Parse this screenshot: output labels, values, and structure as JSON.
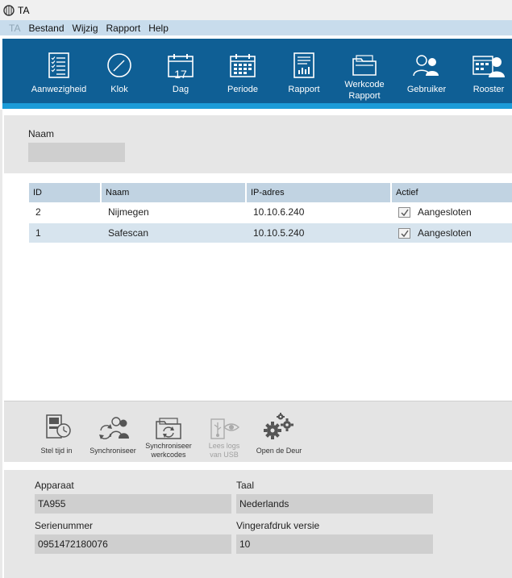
{
  "window": {
    "title": "TA"
  },
  "menu": {
    "items": [
      "TA",
      "Bestand",
      "Wijzig",
      "Rapport",
      "Help"
    ]
  },
  "toolbar": {
    "buttons": [
      {
        "label": "Aanwezigheid",
        "icon": "attendance-list-icon"
      },
      {
        "label": "Klok",
        "icon": "clock-icon"
      },
      {
        "label": "Dag",
        "icon": "calendar-day-icon",
        "day_number": "17"
      },
      {
        "label": "Periode",
        "icon": "calendar-period-icon"
      },
      {
        "label": "Rapport",
        "icon": "report-icon"
      },
      {
        "label_line1": "Werkcode",
        "label_line2": "Rapport",
        "icon": "folder-report-icon"
      },
      {
        "label": "Gebruiker",
        "icon": "users-icon"
      },
      {
        "label": "Rooster",
        "icon": "schedule-icon"
      }
    ]
  },
  "filter": {
    "name_label": "Naam",
    "name_value": ""
  },
  "devices_table": {
    "columns": [
      "ID",
      "Naam",
      "IP-adres",
      "Actief"
    ],
    "rows": [
      {
        "id": "2",
        "naam": "Nijmegen",
        "ip": "10.10.6.240",
        "actief": "Aangesloten",
        "checked": true
      },
      {
        "id": "1",
        "naam": "Safescan",
        "ip": "10.10.5.240",
        "actief": "Aangesloten",
        "checked": true
      }
    ]
  },
  "actions": [
    {
      "label": "Stel tijd in",
      "icon": "set-time-icon",
      "enabled": true
    },
    {
      "label": "Synchroniseer",
      "icon": "sync-users-icon",
      "enabled": true
    },
    {
      "label_line1": "Synchroniseer",
      "label_line2": "werkcodes",
      "icon": "sync-folder-icon",
      "enabled": true
    },
    {
      "label_line1": "Lees logs",
      "label_line2": "van USB",
      "icon": "usb-icon",
      "enabled": false
    },
    {
      "label": "Open de Deur",
      "icon": "gears-icon",
      "enabled": true
    }
  ],
  "device_info": {
    "apparaat_label": "Apparaat",
    "apparaat_value": "TA955",
    "taal_label": "Taal",
    "taal_value": "Nederlands",
    "serienummer_label": "Serienummer",
    "serienummer_value": "0951472180076",
    "vingerafdruk_label": "Vingerafdruk versie",
    "vingerafdruk_value": "10"
  },
  "colors": {
    "toolbar_bg": "#0f5f95",
    "toolbar_stripe": "#1b9bd8",
    "menubar_bg": "#c8dcec",
    "table_header_bg": "#c1d3e2",
    "row_alt_bg": "#d7e4ee"
  }
}
